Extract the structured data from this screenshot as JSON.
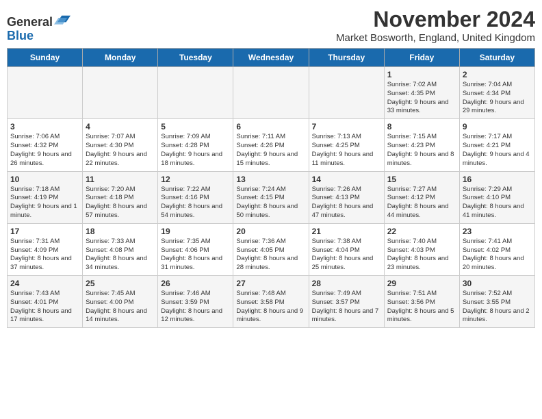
{
  "header": {
    "logo_line1": "General",
    "logo_line2": "Blue",
    "title": "November 2024",
    "subtitle": "Market Bosworth, England, United Kingdom"
  },
  "weekdays": [
    "Sunday",
    "Monday",
    "Tuesday",
    "Wednesday",
    "Thursday",
    "Friday",
    "Saturday"
  ],
  "weeks": [
    [
      {
        "day": "",
        "info": ""
      },
      {
        "day": "",
        "info": ""
      },
      {
        "day": "",
        "info": ""
      },
      {
        "day": "",
        "info": ""
      },
      {
        "day": "",
        "info": ""
      },
      {
        "day": "1",
        "info": "Sunrise: 7:02 AM\nSunset: 4:35 PM\nDaylight: 9 hours and 33 minutes."
      },
      {
        "day": "2",
        "info": "Sunrise: 7:04 AM\nSunset: 4:34 PM\nDaylight: 9 hours and 29 minutes."
      }
    ],
    [
      {
        "day": "3",
        "info": "Sunrise: 7:06 AM\nSunset: 4:32 PM\nDaylight: 9 hours and 26 minutes."
      },
      {
        "day": "4",
        "info": "Sunrise: 7:07 AM\nSunset: 4:30 PM\nDaylight: 9 hours and 22 minutes."
      },
      {
        "day": "5",
        "info": "Sunrise: 7:09 AM\nSunset: 4:28 PM\nDaylight: 9 hours and 18 minutes."
      },
      {
        "day": "6",
        "info": "Sunrise: 7:11 AM\nSunset: 4:26 PM\nDaylight: 9 hours and 15 minutes."
      },
      {
        "day": "7",
        "info": "Sunrise: 7:13 AM\nSunset: 4:25 PM\nDaylight: 9 hours and 11 minutes."
      },
      {
        "day": "8",
        "info": "Sunrise: 7:15 AM\nSunset: 4:23 PM\nDaylight: 9 hours and 8 minutes."
      },
      {
        "day": "9",
        "info": "Sunrise: 7:17 AM\nSunset: 4:21 PM\nDaylight: 9 hours and 4 minutes."
      }
    ],
    [
      {
        "day": "10",
        "info": "Sunrise: 7:18 AM\nSunset: 4:19 PM\nDaylight: 9 hours and 1 minute."
      },
      {
        "day": "11",
        "info": "Sunrise: 7:20 AM\nSunset: 4:18 PM\nDaylight: 8 hours and 57 minutes."
      },
      {
        "day": "12",
        "info": "Sunrise: 7:22 AM\nSunset: 4:16 PM\nDaylight: 8 hours and 54 minutes."
      },
      {
        "day": "13",
        "info": "Sunrise: 7:24 AM\nSunset: 4:15 PM\nDaylight: 8 hours and 50 minutes."
      },
      {
        "day": "14",
        "info": "Sunrise: 7:26 AM\nSunset: 4:13 PM\nDaylight: 8 hours and 47 minutes."
      },
      {
        "day": "15",
        "info": "Sunrise: 7:27 AM\nSunset: 4:12 PM\nDaylight: 8 hours and 44 minutes."
      },
      {
        "day": "16",
        "info": "Sunrise: 7:29 AM\nSunset: 4:10 PM\nDaylight: 8 hours and 41 minutes."
      }
    ],
    [
      {
        "day": "17",
        "info": "Sunrise: 7:31 AM\nSunset: 4:09 PM\nDaylight: 8 hours and 37 minutes."
      },
      {
        "day": "18",
        "info": "Sunrise: 7:33 AM\nSunset: 4:08 PM\nDaylight: 8 hours and 34 minutes."
      },
      {
        "day": "19",
        "info": "Sunrise: 7:35 AM\nSunset: 4:06 PM\nDaylight: 8 hours and 31 minutes."
      },
      {
        "day": "20",
        "info": "Sunrise: 7:36 AM\nSunset: 4:05 PM\nDaylight: 8 hours and 28 minutes."
      },
      {
        "day": "21",
        "info": "Sunrise: 7:38 AM\nSunset: 4:04 PM\nDaylight: 8 hours and 25 minutes."
      },
      {
        "day": "22",
        "info": "Sunrise: 7:40 AM\nSunset: 4:03 PM\nDaylight: 8 hours and 23 minutes."
      },
      {
        "day": "23",
        "info": "Sunrise: 7:41 AM\nSunset: 4:02 PM\nDaylight: 8 hours and 20 minutes."
      }
    ],
    [
      {
        "day": "24",
        "info": "Sunrise: 7:43 AM\nSunset: 4:01 PM\nDaylight: 8 hours and 17 minutes."
      },
      {
        "day": "25",
        "info": "Sunrise: 7:45 AM\nSunset: 4:00 PM\nDaylight: 8 hours and 14 minutes."
      },
      {
        "day": "26",
        "info": "Sunrise: 7:46 AM\nSunset: 3:59 PM\nDaylight: 8 hours and 12 minutes."
      },
      {
        "day": "27",
        "info": "Sunrise: 7:48 AM\nSunset: 3:58 PM\nDaylight: 8 hours and 9 minutes."
      },
      {
        "day": "28",
        "info": "Sunrise: 7:49 AM\nSunset: 3:57 PM\nDaylight: 8 hours and 7 minutes."
      },
      {
        "day": "29",
        "info": "Sunrise: 7:51 AM\nSunset: 3:56 PM\nDaylight: 8 hours and 5 minutes."
      },
      {
        "day": "30",
        "info": "Sunrise: 7:52 AM\nSunset: 3:55 PM\nDaylight: 8 hours and 2 minutes."
      }
    ]
  ]
}
